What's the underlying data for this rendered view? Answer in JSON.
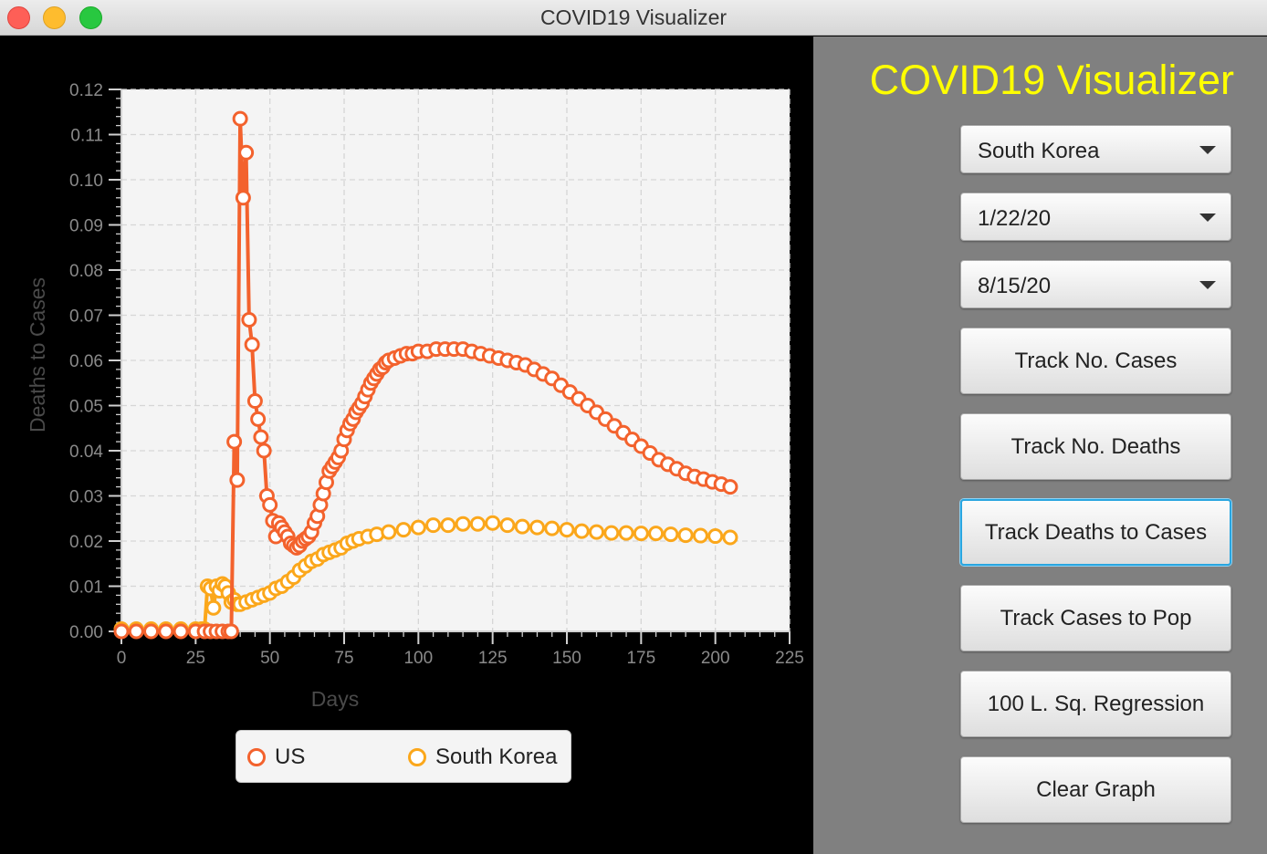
{
  "window": {
    "title": "COVID19 Visualizer"
  },
  "sidebar": {
    "app_title": "COVID19 Visualizer",
    "country_select": "South Korea",
    "start_date_select": "1/22/20",
    "end_date_select": "8/15/20",
    "buttons": {
      "track_cases": "Track No. Cases",
      "track_deaths": "Track No. Deaths",
      "track_deaths_to_cases": "Track Deaths to Cases",
      "track_cases_to_pop": "Track Cases to Pop",
      "regression": "100 L. Sq. Regression",
      "clear_graph": "Clear Graph"
    },
    "focused_button": "track_deaths_to_cases"
  },
  "chart_data": {
    "type": "line",
    "xlabel": "Days",
    "ylabel": "Deaths to Cases",
    "xlim": [
      0,
      225
    ],
    "ylim": [
      0,
      0.12
    ],
    "x_ticks": [
      0,
      25,
      50,
      75,
      100,
      125,
      150,
      175,
      200,
      225
    ],
    "x_tick_labels": [
      "0",
      "25",
      "50",
      "75",
      "100",
      "125",
      "150",
      "175",
      "200",
      "225"
    ],
    "y_ticks": [
      0,
      0.01,
      0.02,
      0.03,
      0.04,
      0.05,
      0.06,
      0.07,
      0.08,
      0.09,
      0.1,
      0.11,
      0.12
    ],
    "y_tick_labels": [
      "0.00",
      "0.01",
      "0.02",
      "0.03",
      "0.04",
      "0.05",
      "0.06",
      "0.07",
      "0.08",
      "0.09",
      "0.10",
      "0.11",
      "0.12"
    ],
    "grid": true,
    "legend_position": "bottom",
    "plot_background": "#f4f4f4",
    "series": [
      {
        "name": "US",
        "color": "#f3622d",
        "points": [
          [
            0,
            0
          ],
          [
            5,
            0
          ],
          [
            10,
            0
          ],
          [
            15,
            0
          ],
          [
            20,
            0
          ],
          [
            25,
            0
          ],
          [
            28,
            0
          ],
          [
            30,
            0
          ],
          [
            32,
            0
          ],
          [
            34,
            0
          ],
          [
            36,
            0
          ],
          [
            37,
            0
          ],
          [
            38,
            0.042
          ],
          [
            39,
            0.0335
          ],
          [
            40,
            0.1135
          ],
          [
            41,
            0.096
          ],
          [
            42,
            0.106
          ],
          [
            43,
            0.069
          ],
          [
            44,
            0.0635
          ],
          [
            45,
            0.051
          ],
          [
            46,
            0.047
          ],
          [
            47,
            0.043
          ],
          [
            48,
            0.04
          ],
          [
            49,
            0.03
          ],
          [
            50,
            0.028
          ],
          [
            51,
            0.0245
          ],
          [
            52,
            0.021
          ],
          [
            53,
            0.024
          ],
          [
            54,
            0.023
          ],
          [
            55,
            0.022
          ],
          [
            56,
            0.021
          ],
          [
            57,
            0.0195
          ],
          [
            58,
            0.019
          ],
          [
            59,
            0.0185
          ],
          [
            60,
            0.019
          ],
          [
            61,
            0.02
          ],
          [
            62,
            0.0205
          ],
          [
            63,
            0.021
          ],
          [
            64,
            0.022
          ],
          [
            65,
            0.024
          ],
          [
            66,
            0.0255
          ],
          [
            67,
            0.028
          ],
          [
            68,
            0.0305
          ],
          [
            69,
            0.033
          ],
          [
            70,
            0.0355
          ],
          [
            71,
            0.0365
          ],
          [
            72,
            0.0375
          ],
          [
            73,
            0.0385
          ],
          [
            74,
            0.04
          ],
          [
            75,
            0.0425
          ],
          [
            76,
            0.0445
          ],
          [
            77,
            0.046
          ],
          [
            78,
            0.047
          ],
          [
            79,
            0.0485
          ],
          [
            80,
            0.0495
          ],
          [
            81,
            0.0505
          ],
          [
            82,
            0.052
          ],
          [
            83,
            0.0535
          ],
          [
            84,
            0.055
          ],
          [
            85,
            0.056
          ],
          [
            86,
            0.057
          ],
          [
            87,
            0.058
          ],
          [
            88,
            0.0585
          ],
          [
            89,
            0.0595
          ],
          [
            90,
            0.06
          ],
          [
            92,
            0.0605
          ],
          [
            94,
            0.061
          ],
          [
            96,
            0.0615
          ],
          [
            98,
            0.0615
          ],
          [
            100,
            0.062
          ],
          [
            103,
            0.062
          ],
          [
            106,
            0.0625
          ],
          [
            109,
            0.0625
          ],
          [
            112,
            0.0625
          ],
          [
            115,
            0.0625
          ],
          [
            118,
            0.062
          ],
          [
            121,
            0.0615
          ],
          [
            124,
            0.061
          ],
          [
            127,
            0.0605
          ],
          [
            130,
            0.06
          ],
          [
            133,
            0.0595
          ],
          [
            136,
            0.059
          ],
          [
            139,
            0.058
          ],
          [
            142,
            0.057
          ],
          [
            145,
            0.056
          ],
          [
            148,
            0.0545
          ],
          [
            151,
            0.053
          ],
          [
            154,
            0.0515
          ],
          [
            157,
            0.05
          ],
          [
            160,
            0.0485
          ],
          [
            163,
            0.047
          ],
          [
            166,
            0.0455
          ],
          [
            169,
            0.044
          ],
          [
            172,
            0.0425
          ],
          [
            175,
            0.041
          ],
          [
            178,
            0.0395
          ],
          [
            181,
            0.038
          ],
          [
            184,
            0.037
          ],
          [
            187,
            0.036
          ],
          [
            190,
            0.035
          ],
          [
            193,
            0.0343
          ],
          [
            196,
            0.0337
          ],
          [
            199,
            0.0331
          ],
          [
            202,
            0.0326
          ],
          [
            205,
            0.032
          ]
        ]
      },
      {
        "name": "South Korea",
        "color": "#fba71b",
        "points": [
          [
            0,
            0.0005
          ],
          [
            5,
            0.0005
          ],
          [
            10,
            0.0005
          ],
          [
            15,
            0.0005
          ],
          [
            20,
            0.0005
          ],
          [
            25,
            0.0005
          ],
          [
            27,
            0.0005
          ],
          [
            28,
            0.0005
          ],
          [
            29,
            0.01
          ],
          [
            30,
            0.0095
          ],
          [
            31,
            0.0052
          ],
          [
            32,
            0.01
          ],
          [
            33,
            0.009
          ],
          [
            34,
            0.0105
          ],
          [
            35,
            0.01
          ],
          [
            36,
            0.0085
          ],
          [
            37,
            0.0065
          ],
          [
            38,
            0.007
          ],
          [
            39,
            0.006
          ],
          [
            40,
            0.006
          ],
          [
            42,
            0.0065
          ],
          [
            44,
            0.007
          ],
          [
            46,
            0.0075
          ],
          [
            48,
            0.008
          ],
          [
            50,
            0.0085
          ],
          [
            52,
            0.0095
          ],
          [
            54,
            0.01
          ],
          [
            56,
            0.011
          ],
          [
            58,
            0.012
          ],
          [
            60,
            0.0135
          ],
          [
            62,
            0.0145
          ],
          [
            64,
            0.0155
          ],
          [
            66,
            0.016
          ],
          [
            68,
            0.017
          ],
          [
            70,
            0.0175
          ],
          [
            72,
            0.018
          ],
          [
            74,
            0.0185
          ],
          [
            76,
            0.0195
          ],
          [
            78,
            0.02
          ],
          [
            80,
            0.0205
          ],
          [
            83,
            0.021
          ],
          [
            86,
            0.0215
          ],
          [
            90,
            0.022
          ],
          [
            95,
            0.0225
          ],
          [
            100,
            0.023
          ],
          [
            105,
            0.0235
          ],
          [
            110,
            0.0235
          ],
          [
            115,
            0.0238
          ],
          [
            120,
            0.0238
          ],
          [
            125,
            0.024
          ],
          [
            130,
            0.0235
          ],
          [
            135,
            0.0232
          ],
          [
            140,
            0.023
          ],
          [
            145,
            0.0228
          ],
          [
            150,
            0.0225
          ],
          [
            155,
            0.0222
          ],
          [
            160,
            0.022
          ],
          [
            165,
            0.0218
          ],
          [
            170,
            0.0218
          ],
          [
            175,
            0.0217
          ],
          [
            180,
            0.0217
          ],
          [
            185,
            0.0215
          ],
          [
            190,
            0.0213
          ],
          [
            195,
            0.0212
          ],
          [
            200,
            0.0211
          ],
          [
            205,
            0.0208
          ]
        ]
      }
    ]
  }
}
